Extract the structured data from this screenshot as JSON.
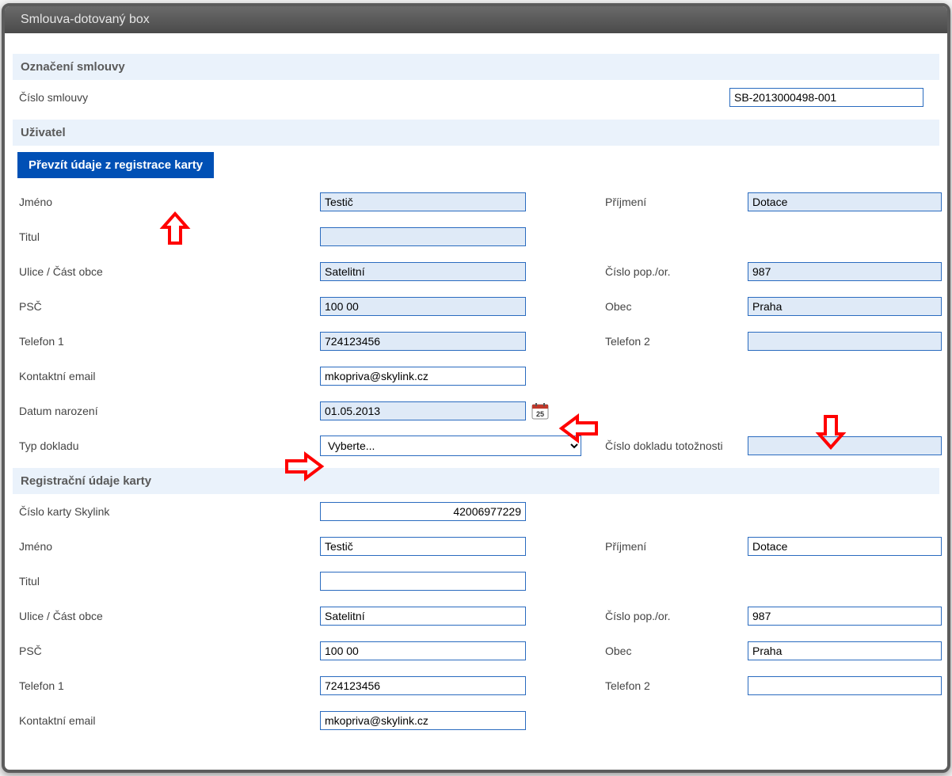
{
  "window": {
    "title": "Smlouva-dotovaný box"
  },
  "sections": {
    "contract": {
      "header": "Označení smlouvy",
      "numberLabel": "Číslo smlouvy",
      "numberValue": "SB-2013000498-001"
    },
    "user": {
      "header": "Uživatel",
      "buttonLabel": "Převzít údaje z registrace karty",
      "labels": {
        "firstName": "Jméno",
        "lastName": "Příjmení",
        "title": "Titul",
        "street": "Ulice / Část obce",
        "houseNo": "Číslo pop./or.",
        "zip": "PSČ",
        "city": "Obec",
        "phone1": "Telefon 1",
        "phone2": "Telefon 2",
        "email": "Kontaktní email",
        "birthDate": "Datum narození",
        "docType": "Typ dokladu",
        "docNumber": "Číslo dokladu totožnosti"
      },
      "values": {
        "firstName": "Testič",
        "lastName": "Dotace",
        "title": "",
        "street": "Satelitní",
        "houseNo": "987",
        "zip": "100 00",
        "city": "Praha",
        "phone1": "724123456",
        "phone2": "",
        "email": "mkopriva@skylink.cz",
        "birthDate": "01.05.2013",
        "docTypeSelected": "Vyberte...",
        "docNumber": ""
      }
    },
    "card": {
      "header": "Registrační údaje karty",
      "labels": {
        "cardNo": "Číslo karty Skylink",
        "firstName": "Jméno",
        "lastName": "Příjmení",
        "title": "Titul",
        "street": "Ulice / Část obce",
        "houseNo": "Číslo pop./or.",
        "zip": "PSČ",
        "city": "Obec",
        "phone1": "Telefon 1",
        "phone2": "Telefon 2",
        "email": "Kontaktní email"
      },
      "values": {
        "cardNo": "42006977229",
        "firstName": "Testič",
        "lastName": "Dotace",
        "title": "",
        "street": "Satelitní",
        "houseNo": "987",
        "zip": "100 00",
        "city": "Praha",
        "phone1": "724123456",
        "phone2": "",
        "email": "mkopriva@skylink.cz"
      }
    }
  },
  "colors": {
    "sectionBg": "#eaf2fb",
    "inputBorder": "#2a6bbf",
    "blueFill": "#dfeaf7",
    "buttonBg": "#0050b5",
    "annotationRed": "#ff0000"
  }
}
